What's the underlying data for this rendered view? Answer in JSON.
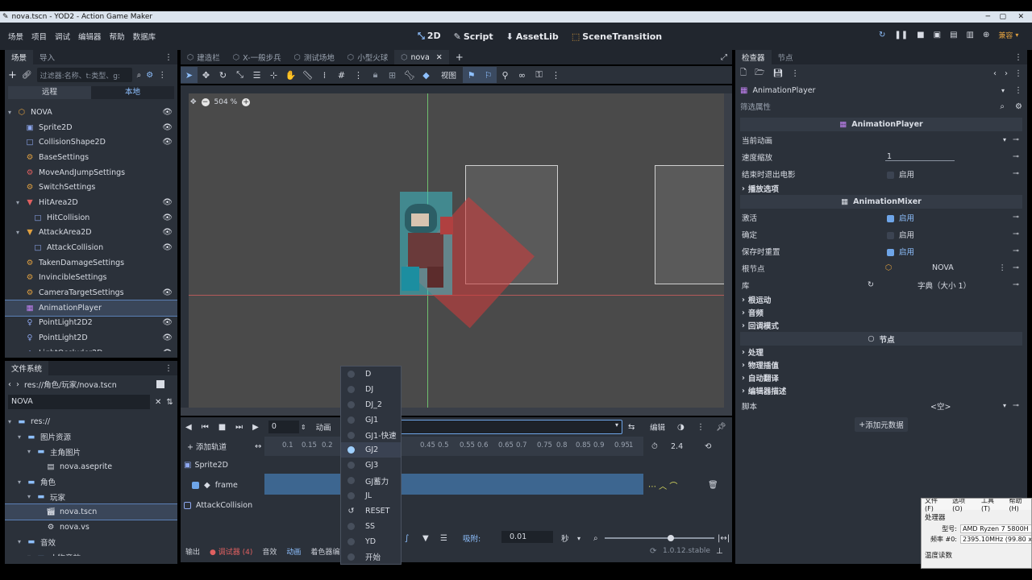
{
  "window": {
    "title": "nova.tscn - YOD2 - Action Game Maker"
  },
  "menu": [
    "场景",
    "项目",
    "调试",
    "编辑器",
    "帮助",
    "数据库"
  ],
  "workspaces": [
    {
      "icon": "2d-icon",
      "label": "2D"
    },
    {
      "icon": "script-icon",
      "label": "Script"
    },
    {
      "icon": "assetlib-icon",
      "label": "AssetLib"
    },
    {
      "icon": "scenetransition-icon",
      "label": "SceneTransition"
    }
  ],
  "renderer": "兼容",
  "scene_dock": {
    "tabs": [
      "场景",
      "导入"
    ],
    "filter_placeholder": "过滤器:名称、t:类型、g:",
    "remote": "远程",
    "local": "本地",
    "nodes": [
      {
        "name": "NOVA",
        "depth": 0,
        "icon": "node2d-icon",
        "color": "#e0a040",
        "expand": "▾"
      },
      {
        "name": "Sprite2D",
        "depth": 1,
        "icon": "sprite-icon",
        "color": "#8ea8f0",
        "expand": ""
      },
      {
        "name": "CollisionShape2D",
        "depth": 1,
        "icon": "collision-icon",
        "color": "#8ea8f0",
        "expand": ""
      },
      {
        "name": "BaseSettings",
        "depth": 1,
        "icon": "settings-icon",
        "color": "#e0a040",
        "expand": ""
      },
      {
        "name": "MoveAndJumpSettings",
        "depth": 1,
        "icon": "settings-icon",
        "color": "#e06060",
        "expand": ""
      },
      {
        "name": "SwitchSettings",
        "depth": 1,
        "icon": "settings-icon",
        "color": "#e0a040",
        "expand": ""
      },
      {
        "name": "HitArea2D",
        "depth": 1,
        "icon": "area-icon",
        "color": "#e06060",
        "expand": "▾"
      },
      {
        "name": "HitCollision",
        "depth": 2,
        "icon": "collision-icon",
        "color": "#8ea8f0",
        "expand": ""
      },
      {
        "name": "AttackArea2D",
        "depth": 1,
        "icon": "area-icon",
        "color": "#e0a040",
        "expand": "▾"
      },
      {
        "name": "AttackCollision",
        "depth": 2,
        "icon": "collision-icon",
        "color": "#8ea8f0",
        "expand": ""
      },
      {
        "name": "TakenDamageSettings",
        "depth": 1,
        "icon": "settings-icon",
        "color": "#e0a040",
        "expand": ""
      },
      {
        "name": "InvincibleSettings",
        "depth": 1,
        "icon": "settings-icon",
        "color": "#e0a040",
        "expand": ""
      },
      {
        "name": "CameraTargetSettings",
        "depth": 1,
        "icon": "settings-icon",
        "color": "#e0a040",
        "expand": ""
      },
      {
        "name": "AnimationPlayer",
        "depth": 1,
        "icon": "animation-icon",
        "color": "#c080f0",
        "expand": ""
      },
      {
        "name": "PointLight2D2",
        "depth": 1,
        "icon": "light-icon",
        "color": "#8ea8f0",
        "expand": ""
      },
      {
        "name": "PointLight2D",
        "depth": 1,
        "icon": "light-icon",
        "color": "#8ea8f0",
        "expand": ""
      },
      {
        "name": "LightOccluder2D",
        "depth": 1,
        "icon": "occluder-icon",
        "color": "#8ea8f0",
        "expand": ""
      }
    ]
  },
  "filesystem": {
    "title": "文件系统",
    "path": "res://角色/玩家/nova.tscn",
    "search": "NOVA",
    "items": [
      {
        "name": "res://",
        "depth": 0,
        "icon": "folder-icon"
      },
      {
        "name": "图片资源",
        "depth": 1,
        "icon": "folder-icon"
      },
      {
        "name": "主角图片",
        "depth": 2,
        "icon": "folder-icon"
      },
      {
        "name": "nova.aseprite",
        "depth": 3,
        "icon": "file-icon"
      },
      {
        "name": "角色",
        "depth": 1,
        "icon": "folder-icon"
      },
      {
        "name": "玩家",
        "depth": 2,
        "icon": "folder-icon"
      },
      {
        "name": "nova.tscn",
        "depth": 3,
        "icon": "scene-icon"
      },
      {
        "name": "nova.vs",
        "depth": 3,
        "icon": "gear-icon"
      },
      {
        "name": "音效",
        "depth": 1,
        "icon": "folder-icon"
      },
      {
        "name": "人物音效",
        "depth": 2,
        "icon": "folder-icon"
      }
    ]
  },
  "editor_tabs": [
    "建造栏",
    "X-一般步兵",
    "测试场地",
    "小型火球",
    "nova"
  ],
  "toolbar": {
    "view_label": "视图"
  },
  "viewport": {
    "zoom": "504 %"
  },
  "animation": {
    "time": "0",
    "anim_label": "动画",
    "edit_label": "编辑",
    "add_track": "添加轨道",
    "ticks": [
      "0.1",
      "0.15",
      "0.2",
      "0.45",
      "0.5",
      "0.55",
      "0.6",
      "0.65",
      "0.7",
      "0.75",
      "0.8",
      "0.85",
      "0.9",
      "0.95",
      "1"
    ],
    "length": "2.4",
    "tracks": [
      "Sprite2D",
      "frame",
      "AttackCollision"
    ],
    "snap_label": "吸附:",
    "snap_value": "0.01",
    "snap_unit": "秒"
  },
  "dropdown": {
    "items": [
      "D",
      "DJ",
      "DJ_2",
      "GJ1",
      "GJ1-快速",
      "GJ2",
      "GJ3",
      "GJ蓄力",
      "JL",
      "RESET",
      "SS",
      "YD",
      "开始"
    ],
    "highlighted": "GJ2"
  },
  "bottom_tabs": [
    "输出",
    "调试器 (4)",
    "音效",
    "动画",
    "着色器编辑"
  ],
  "version": "1.0.12.stable",
  "inspector": {
    "tabs": [
      "检查器",
      "节点"
    ],
    "node_name": "AnimationPlayer",
    "filter": "筛选属性",
    "section_player": "AnimationPlayer",
    "current_anim": "当前动画",
    "speed_label": "速度缩放",
    "speed_value": "1",
    "movie_quit": "结束时退出电影",
    "enable": "启用",
    "playback_options": "播放选项",
    "section_mixer": "AnimationMixer",
    "active": "激活",
    "deterministic": "确定",
    "reset_on_save": "保存时重置",
    "root_node": "根节点",
    "root_value": "NOVA",
    "library": "库",
    "library_value": "字典（大小 1）",
    "groups": [
      "根运动",
      "音频",
      "回调模式"
    ],
    "section_node": "节点",
    "node_groups": [
      "处理",
      "物理插值",
      "自动翻译",
      "编辑器描述"
    ],
    "script_label": "脚本",
    "script_value": "<空>",
    "add_meta": "添加元数据"
  },
  "sysinfo": {
    "menu": [
      "文件(F)",
      "选项(O)",
      "工具(T)",
      "帮助(H)"
    ],
    "processor": "处理器",
    "model_label": "型号:",
    "model": "AMD Ryzen 7 5800H (Cezan",
    "freq_label": "频率 #0:",
    "freq": "2395.10MHz (99.80 x 24.0)",
    "temp": "温度读数"
  },
  "chart_colors": {
    "accent": "#6ea5e8",
    "danger": "#e06060"
  }
}
